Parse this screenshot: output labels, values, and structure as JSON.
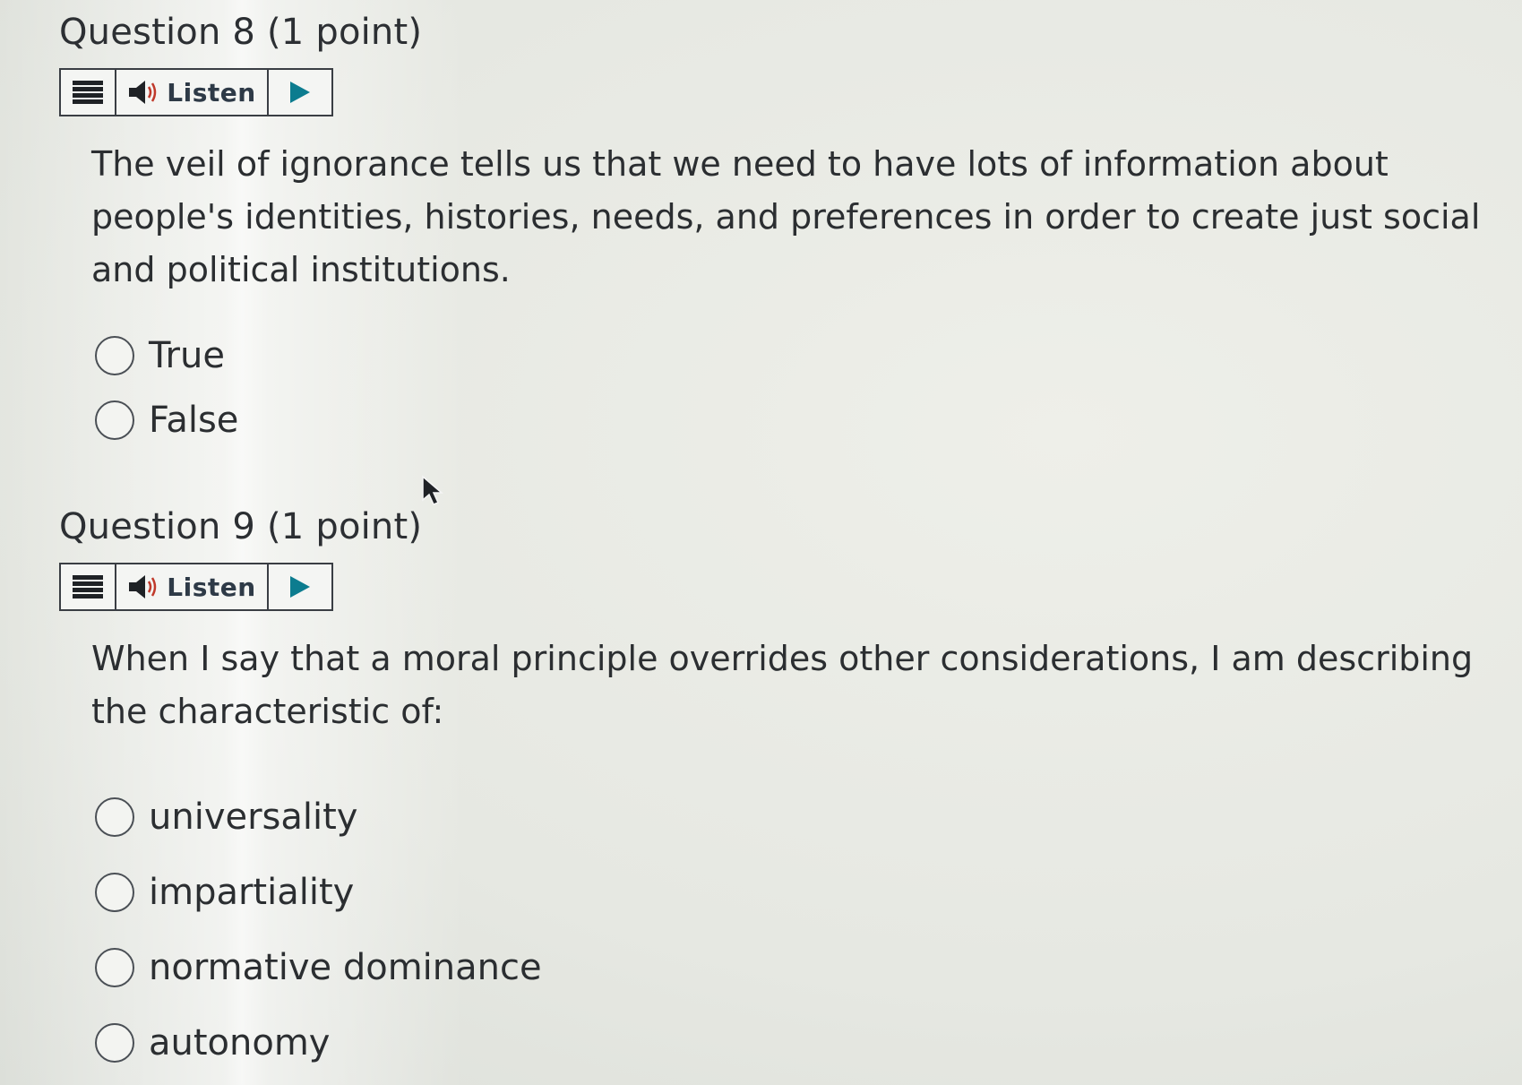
{
  "questions": [
    {
      "title": "Question 8 (1 point)",
      "listen_label": "Listen",
      "text": "The veil of ignorance tells us that we need to have lots of information about people's identities, histories, needs, and preferences in order to create just social and political institutions.",
      "options": [
        "True",
        "False"
      ]
    },
    {
      "title": "Question 9 (1 point)",
      "listen_label": "Listen",
      "text": "When I say that a moral principle overrides other considerations, I am describing the characteristic of:",
      "options": [
        "universality",
        "impartiality",
        "normative dominance",
        "autonomy"
      ]
    }
  ],
  "colors": {
    "play_accent": "#0c7c8f",
    "text": "#2b2e31"
  },
  "icons": {
    "menu": "hamburger-menu-icon",
    "audio": "speaker-icon",
    "play": "play-icon",
    "pointer": "mouse-cursor-icon"
  }
}
